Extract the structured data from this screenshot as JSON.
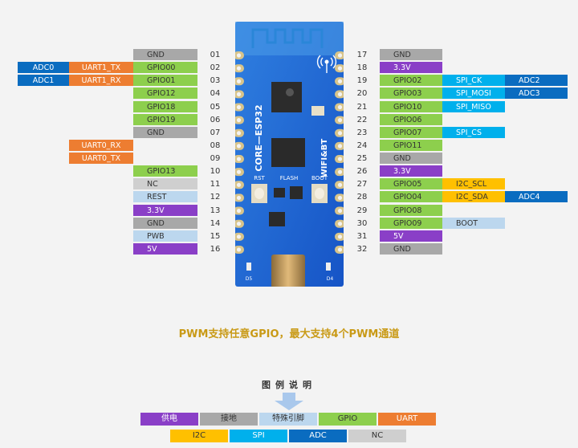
{
  "left_pins": [
    {
      "num": "01",
      "main": {
        "label": "GND",
        "type": "gnd"
      }
    },
    {
      "num": "02",
      "main": {
        "label": "GPIO00",
        "type": "gpio"
      },
      "alt1": {
        "label": "UART1_TX",
        "type": "uart"
      },
      "alt2": {
        "label": "ADC0",
        "type": "adc"
      }
    },
    {
      "num": "03",
      "main": {
        "label": "GPIO01",
        "type": "gpio"
      },
      "alt1": {
        "label": "UART1_RX",
        "type": "uart"
      },
      "alt2": {
        "label": "ADC1",
        "type": "adc"
      }
    },
    {
      "num": "04",
      "main": {
        "label": "GPIO12",
        "type": "gpio"
      }
    },
    {
      "num": "05",
      "main": {
        "label": "GPIO18",
        "type": "gpio"
      }
    },
    {
      "num": "06",
      "main": {
        "label": "GPIO19",
        "type": "gpio"
      }
    },
    {
      "num": "07",
      "main": {
        "label": "GND",
        "type": "gnd"
      }
    },
    {
      "num": "08",
      "alt1": {
        "label": "UART0_RX",
        "type": "uart"
      }
    },
    {
      "num": "09",
      "alt1": {
        "label": "UART0_TX",
        "type": "uart"
      }
    },
    {
      "num": "10",
      "main": {
        "label": "GPIO13",
        "type": "gpio"
      }
    },
    {
      "num": "11",
      "main": {
        "label": "NC",
        "type": "nc"
      }
    },
    {
      "num": "12",
      "main": {
        "label": "REST",
        "type": "spec"
      }
    },
    {
      "num": "13",
      "main": {
        "label": "3.3V",
        "type": "pwr"
      }
    },
    {
      "num": "14",
      "main": {
        "label": "GND",
        "type": "gnd"
      }
    },
    {
      "num": "15",
      "main": {
        "label": "PWB",
        "type": "spec"
      }
    },
    {
      "num": "16",
      "main": {
        "label": "5V",
        "type": "pwr"
      }
    }
  ],
  "right_pins": [
    {
      "num": "17",
      "main": {
        "label": "GND",
        "type": "gnd"
      }
    },
    {
      "num": "18",
      "main": {
        "label": "3.3V",
        "type": "pwr"
      }
    },
    {
      "num": "19",
      "main": {
        "label": "GPIO02",
        "type": "gpio"
      },
      "alt1": {
        "label": "SPI_CK",
        "type": "spi"
      },
      "alt2": {
        "label": "ADC2",
        "type": "adc"
      }
    },
    {
      "num": "20",
      "main": {
        "label": "GPIO03",
        "type": "gpio"
      },
      "alt1": {
        "label": "SPI_MOSI",
        "type": "spi"
      },
      "alt2": {
        "label": "ADC3",
        "type": "adc"
      }
    },
    {
      "num": "21",
      "main": {
        "label": "GPIO10",
        "type": "gpio"
      },
      "alt1": {
        "label": "SPI_MISO",
        "type": "spi"
      }
    },
    {
      "num": "22",
      "main": {
        "label": "GPIO06",
        "type": "gpio"
      }
    },
    {
      "num": "23",
      "main": {
        "label": "GPIO07",
        "type": "gpio"
      },
      "alt1": {
        "label": "SPI_CS",
        "type": "spi"
      }
    },
    {
      "num": "24",
      "main": {
        "label": "GPIO11",
        "type": "gpio"
      }
    },
    {
      "num": "25",
      "main": {
        "label": "GND",
        "type": "gnd"
      }
    },
    {
      "num": "26",
      "main": {
        "label": "3.3V",
        "type": "pwr"
      }
    },
    {
      "num": "27",
      "main": {
        "label": "GPIO05",
        "type": "gpio"
      },
      "alt1": {
        "label": "I2C_SCL",
        "type": "i2c"
      }
    },
    {
      "num": "28",
      "main": {
        "label": "GPIO04",
        "type": "gpio"
      },
      "alt1": {
        "label": "I2C_SDA",
        "type": "i2c"
      },
      "alt2": {
        "label": "ADC4",
        "type": "adc"
      }
    },
    {
      "num": "29",
      "main": {
        "label": "GPIO08",
        "type": "gpio"
      }
    },
    {
      "num": "30",
      "main": {
        "label": "GPIO09",
        "type": "gpio"
      },
      "alt1": {
        "label": "BOOT",
        "type": "spec"
      }
    },
    {
      "num": "31",
      "main": {
        "label": "5V",
        "type": "pwr"
      }
    },
    {
      "num": "32",
      "main": {
        "label": "GND",
        "type": "gnd"
      }
    }
  ],
  "board": {
    "silk_left": "CORE—ESP32",
    "silk_right": "WIFI&BT",
    "btn_rst": "RST",
    "flash": "FLASH",
    "btn_boot": "BOOT",
    "led_left": "D5",
    "led_right": "D4"
  },
  "caption": "PWM支持任意GPIO，最大支持4个PWM通道",
  "legend": {
    "title": "图例说明",
    "row1": [
      {
        "label": "供电",
        "type": "pwr"
      },
      {
        "label": "接地",
        "type": "gnd"
      },
      {
        "label": "特殊引脚",
        "type": "spec"
      },
      {
        "label": "GPIO",
        "type": "gpio"
      },
      {
        "label": "UART",
        "type": "uart"
      }
    ],
    "row2": [
      {
        "label": "I2C",
        "type": "i2c"
      },
      {
        "label": "SPI",
        "type": "spi"
      },
      {
        "label": "ADC",
        "type": "adc"
      },
      {
        "label": "NC",
        "type": "nc"
      }
    ]
  },
  "colors": {
    "pwr": "#8a3fc7",
    "gnd": "#a8a8a8",
    "spec": "#bcd7ee",
    "gpio": "#8dcf4d",
    "uart": "#ed7d31",
    "i2c": "#ffc000",
    "spi": "#00b0ec",
    "adc": "#0a6cc0",
    "nc": "#cfcfcf",
    "caption": "#c99a16",
    "board": "#1a5fd0"
  }
}
